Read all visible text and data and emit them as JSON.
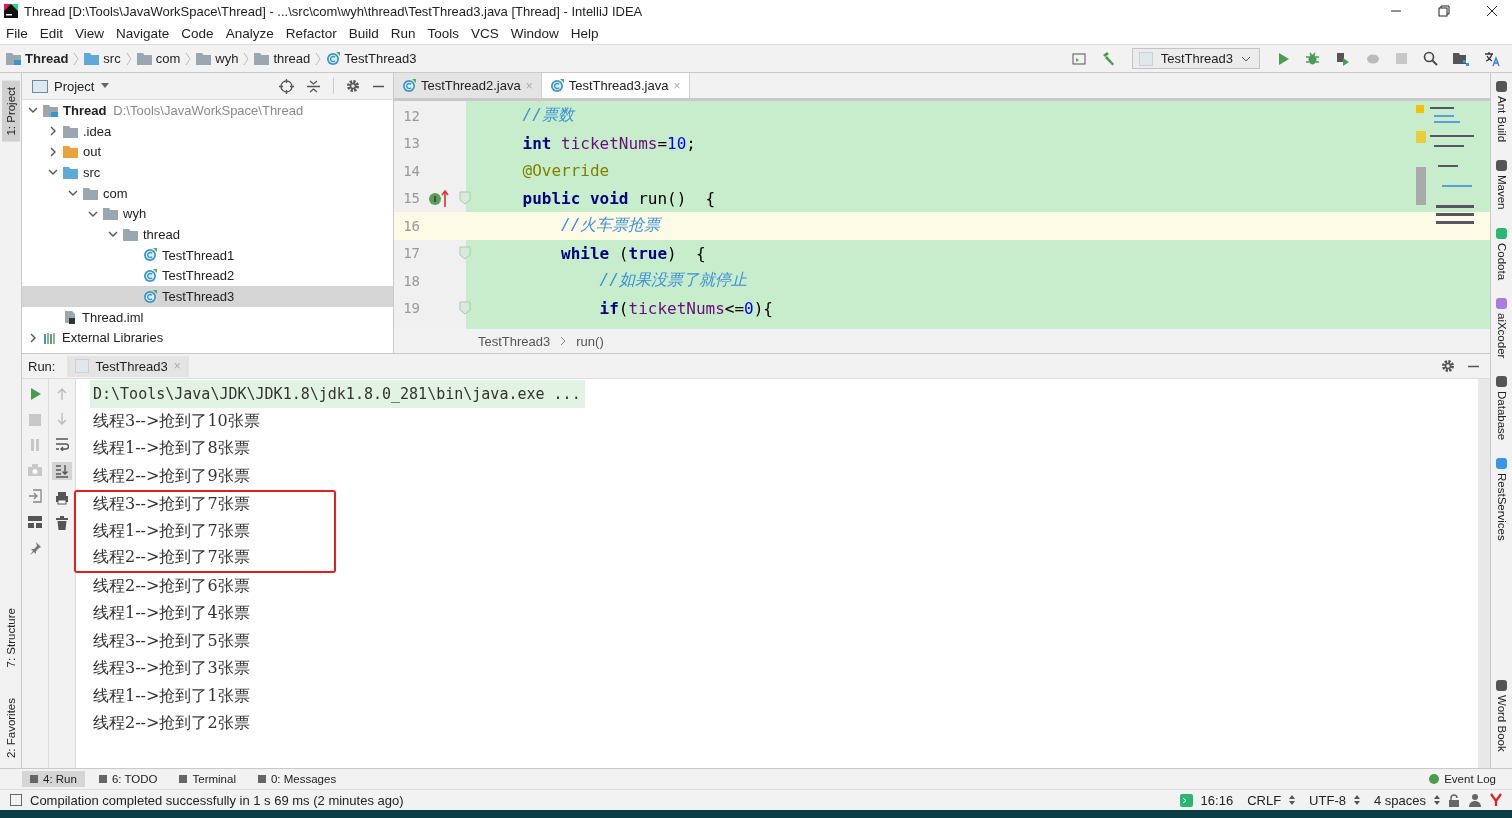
{
  "window": {
    "title": "Thread [D:\\Tools\\JavaWorkSpace\\Thread] - ...\\src\\com\\wyh\\thread\\TestThread3.java [Thread] - IntelliJ IDEA"
  },
  "menu": [
    "File",
    "Edit",
    "View",
    "Navigate",
    "Code",
    "Analyze",
    "Refactor",
    "Build",
    "Run",
    "Tools",
    "VCS",
    "Window",
    "Help"
  ],
  "navigation_bar": [
    {
      "label": "Thread",
      "kind": "module"
    },
    {
      "label": "src",
      "kind": "source_folder"
    },
    {
      "label": "com",
      "kind": "package"
    },
    {
      "label": "wyh",
      "kind": "package"
    },
    {
      "label": "thread",
      "kind": "package"
    },
    {
      "label": "TestThread3",
      "kind": "class"
    }
  ],
  "run_configuration": "TestThread3",
  "left_tool_strip": [
    {
      "label": "1: Project",
      "selected": true
    },
    {
      "label": "7: Structure",
      "selected": false
    },
    {
      "label": "2: Favorites",
      "selected": false
    }
  ],
  "right_tool_strip": [
    "Ant Build",
    "Maven",
    "Codota",
    "aiXcoder",
    "Database",
    "RestServices",
    "Word Book"
  ],
  "project_panel": {
    "title": "Project",
    "tree": [
      {
        "label": "Thread",
        "path": "D:\\Tools\\JavaWorkSpace\\Thread",
        "kind": "module",
        "expanded": true,
        "selected": false,
        "children": [
          {
            "label": ".idea",
            "kind": "folder",
            "expanded": false,
            "selected": false
          },
          {
            "label": "out",
            "kind": "excluded_folder",
            "expanded": false,
            "selected": false
          },
          {
            "label": "src",
            "kind": "source_folder",
            "expanded": true,
            "selected": false,
            "children": [
              {
                "label": "com",
                "kind": "package",
                "expanded": true,
                "selected": false,
                "children": [
                  {
                    "label": "wyh",
                    "kind": "package",
                    "expanded": true,
                    "selected": false,
                    "children": [
                      {
                        "label": "thread",
                        "kind": "package",
                        "expanded": true,
                        "selected": false,
                        "children": [
                          {
                            "label": "TestThread1",
                            "kind": "class",
                            "selected": false
                          },
                          {
                            "label": "TestThread2",
                            "kind": "class",
                            "selected": false
                          },
                          {
                            "label": "TestThread3",
                            "kind": "class",
                            "selected": true
                          }
                        ]
                      }
                    ]
                  }
                ]
              }
            ]
          },
          {
            "label": "Thread.iml",
            "kind": "iml",
            "selected": false
          }
        ]
      },
      {
        "label": "External Libraries",
        "kind": "libraries",
        "expanded": false,
        "selected": false
      }
    ]
  },
  "editor": {
    "tabs": [
      {
        "label": "TestThread2.java",
        "close": "×",
        "selected": false
      },
      {
        "label": "TestThread3.java",
        "close": "×",
        "selected": true
      }
    ],
    "lines": [
      {
        "number": "12",
        "current": false,
        "marker": false,
        "fold": false,
        "tokens": [
          {
            "kind": "comment",
            "text": "    //票数"
          }
        ]
      },
      {
        "number": "13",
        "current": false,
        "marker": false,
        "fold": false,
        "tokens": [
          {
            "kind": "keyword",
            "text": "    int"
          },
          {
            "kind": "field",
            "text": " ticketNums"
          },
          {
            "kind": "plain",
            "text": "="
          },
          {
            "kind": "number",
            "text": "10"
          },
          {
            "kind": "plain",
            "text": ";"
          }
        ]
      },
      {
        "number": "14",
        "current": false,
        "marker": false,
        "fold": false,
        "tokens": [
          {
            "kind": "annotation",
            "text": "    @Override"
          }
        ]
      },
      {
        "number": "15",
        "current": false,
        "marker": true,
        "fold": true,
        "tokens": [
          {
            "kind": "keyword",
            "text": "    public void"
          },
          {
            "kind": "plain",
            "text": " run()  {"
          }
        ]
      },
      {
        "number": "16",
        "current": true,
        "marker": false,
        "fold": false,
        "tokens": [
          {
            "kind": "comment",
            "text": "        //火车票抢票"
          }
        ]
      },
      {
        "number": "17",
        "current": false,
        "marker": false,
        "fold": true,
        "tokens": [
          {
            "kind": "keyword",
            "text": "        while"
          },
          {
            "kind": "plain",
            "text": " ("
          },
          {
            "kind": "keyword",
            "text": "true"
          },
          {
            "kind": "plain",
            "text": ")  {"
          }
        ]
      },
      {
        "number": "18",
        "current": false,
        "marker": false,
        "fold": false,
        "tokens": [
          {
            "kind": "comment",
            "text": "            //如果没票了就停止"
          }
        ]
      },
      {
        "number": "19",
        "current": false,
        "marker": false,
        "fold": true,
        "tokens": [
          {
            "kind": "keyword",
            "text": "            if"
          },
          {
            "kind": "plain",
            "text": "("
          },
          {
            "kind": "field",
            "text": "ticketNums"
          },
          {
            "kind": "plain",
            "text": "<="
          },
          {
            "kind": "number",
            "text": "0"
          },
          {
            "kind": "plain",
            "text": "){"
          }
        ]
      }
    ],
    "breadcrumb": [
      "TestThread3",
      "run()"
    ]
  },
  "run_panel": {
    "label": "Run:",
    "tab": "TestThread3",
    "close": "×",
    "lines": [
      {
        "text": "D:\\Tools\\Java\\JDK\\JDK1.8\\jdk1.8.0_281\\bin\\java.exe ...",
        "kind": "command",
        "boxed": false
      },
      {
        "text": "线程3-->抢到了10张票",
        "kind": "output",
        "boxed": false
      },
      {
        "text": "线程1-->抢到了8张票",
        "kind": "output",
        "boxed": false
      },
      {
        "text": "线程2-->抢到了9张票",
        "kind": "output",
        "boxed": false
      },
      {
        "text": "线程3-->抢到了7张票",
        "kind": "output",
        "boxed": true
      },
      {
        "text": "线程1-->抢到了7张票",
        "kind": "output",
        "boxed": true
      },
      {
        "text": "线程2-->抢到了7张票",
        "kind": "output",
        "boxed": true
      },
      {
        "text": "线程2-->抢到了6张票",
        "kind": "output",
        "boxed": false
      },
      {
        "text": "线程1-->抢到了4张票",
        "kind": "output",
        "boxed": false
      },
      {
        "text": "线程3-->抢到了5张票",
        "kind": "output",
        "boxed": false
      },
      {
        "text": "线程3-->抢到了3张票",
        "kind": "output",
        "boxed": false
      },
      {
        "text": "线程1-->抢到了1张票",
        "kind": "output",
        "boxed": false
      },
      {
        "text": "线程2-->抢到了2张票",
        "kind": "output",
        "boxed": false
      }
    ]
  },
  "bottom_tabs": [
    {
      "label": "4: Run",
      "selected": true
    },
    {
      "label": "6: TODO",
      "selected": false
    },
    {
      "label": "Terminal",
      "selected": false
    },
    {
      "label": "0: Messages",
      "selected": false
    }
  ],
  "event_log": "Event Log",
  "status_bar": {
    "message": "Compilation completed successfully in 1 s 69 ms (2 minutes ago)",
    "position": "16:16",
    "line_separator": "CRLF",
    "encoding": "UTF-8",
    "indent": "4 spaces"
  }
}
